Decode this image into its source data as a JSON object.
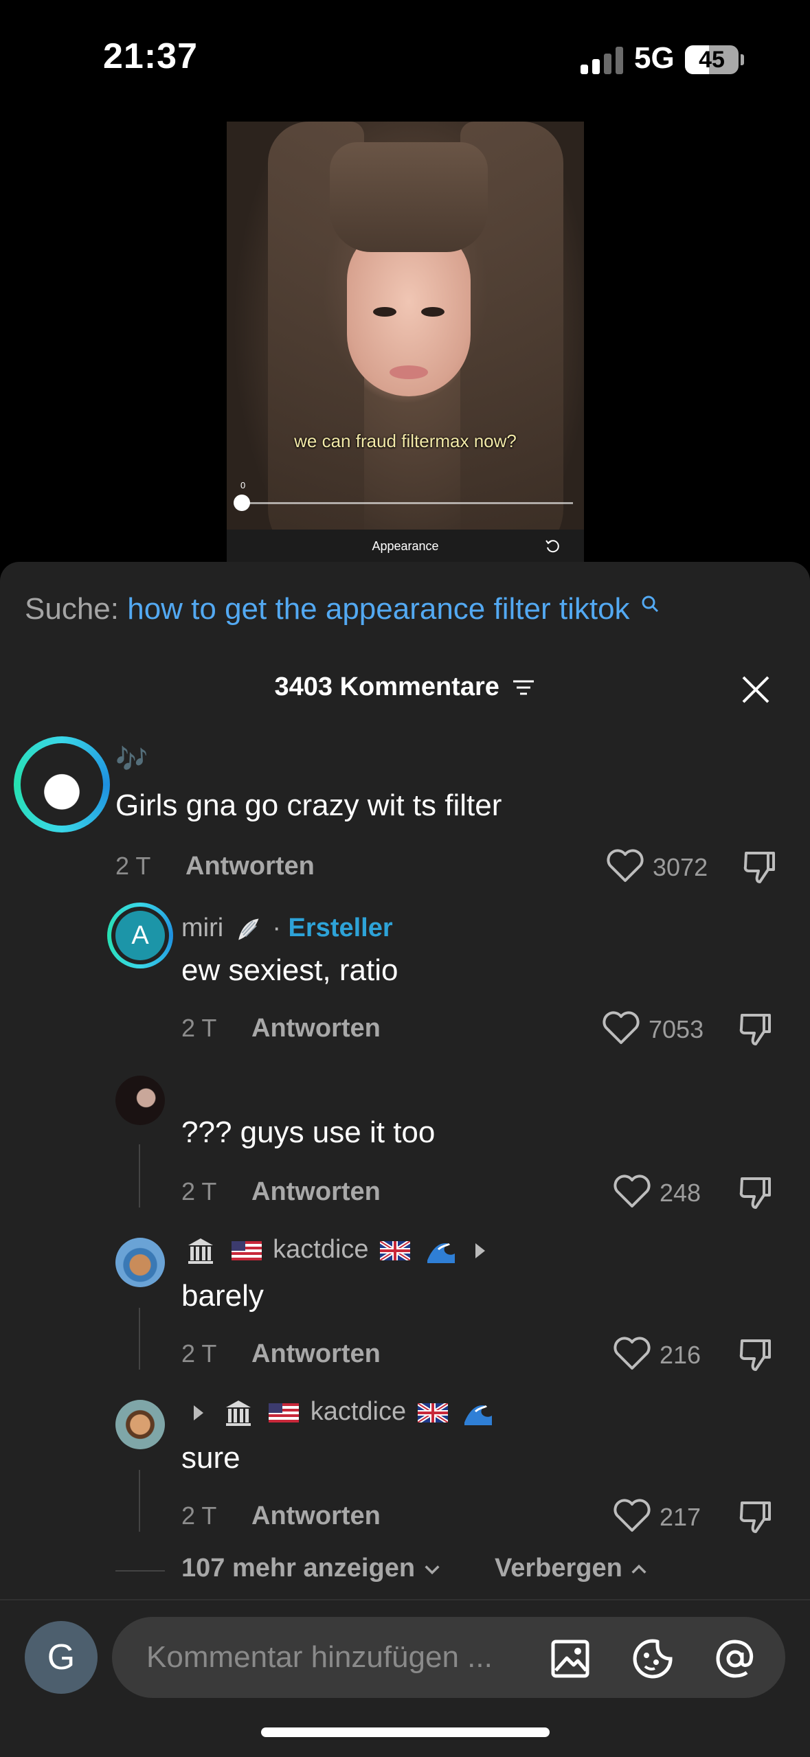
{
  "status": {
    "time": "21:37",
    "network": "5G",
    "battery": "45",
    "battery_level": 0.45
  },
  "video": {
    "caption": "we can fraud filtermax now?",
    "slider_value": "0",
    "effect_label": "Appearance"
  },
  "sheet": {
    "search_prefix": "Suche:",
    "search_query": "how to get the appearance filter tiktok",
    "comment_count": "3403 Kommentare",
    "input_placeholder": "Kommentar hinzufügen ...",
    "user_initial": "G"
  },
  "comments": [
    {
      "username": "",
      "emoji": "🎶",
      "text": "Girls gna go crazy wit ts filter",
      "age": "2 T",
      "reply": "Antworten",
      "likes": "3072"
    },
    {
      "username": "miri",
      "badge_sep": "·",
      "badge": "Ersteller",
      "avatar_initial": "A",
      "text": "ew sexiest, ratio",
      "age": "2 T",
      "reply": "Antworten",
      "likes": "7053"
    },
    {
      "username": "",
      "text": "??? guys use it too",
      "age": "2 T",
      "reply": "Antworten",
      "likes": "248"
    },
    {
      "username": "kactdice",
      "text": "barely",
      "age": "2 T",
      "reply": "Antworten",
      "likes": "216"
    },
    {
      "username": "kactdice",
      "text": "sure",
      "age": "2 T",
      "reply": "Antworten",
      "likes": "217"
    }
  ],
  "thread": {
    "show_more": "107 mehr anzeigen",
    "hide": "Verbergen"
  },
  "colors": {
    "accent": "#53a9f2",
    "creator": "#2ea3d8",
    "sheet_bg": "#222222"
  }
}
